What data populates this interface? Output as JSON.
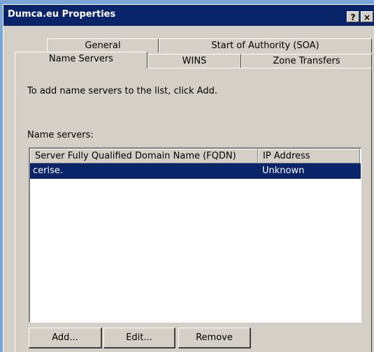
{
  "window": {
    "title": "Dumca.eu Properties",
    "help_glyph": "?",
    "close_glyph": "×"
  },
  "tabs_back": [
    {
      "label": "General"
    },
    {
      "label": "Start of Authority (SOA)"
    }
  ],
  "tabs_front": [
    {
      "label": "Name Servers",
      "active": true
    },
    {
      "label": "WINS"
    },
    {
      "label": "Zone Transfers"
    }
  ],
  "content": {
    "instruction": "To add name servers to the list, click Add.",
    "list_label": "Name servers:",
    "columns": [
      "Server Fully Qualified Domain Name (FQDN)",
      "IP Address"
    ],
    "rows": [
      {
        "fqdn": "cerise.",
        "ip": "Unknown",
        "selected": true
      }
    ]
  },
  "buttons": {
    "add": "Add...",
    "edit": "Edit...",
    "remove": "Remove"
  },
  "colors": {
    "titlebar": "#0a246a",
    "selection": "#0a246a",
    "face": "#d4d0c8",
    "desktop": "#7aa7d6"
  }
}
